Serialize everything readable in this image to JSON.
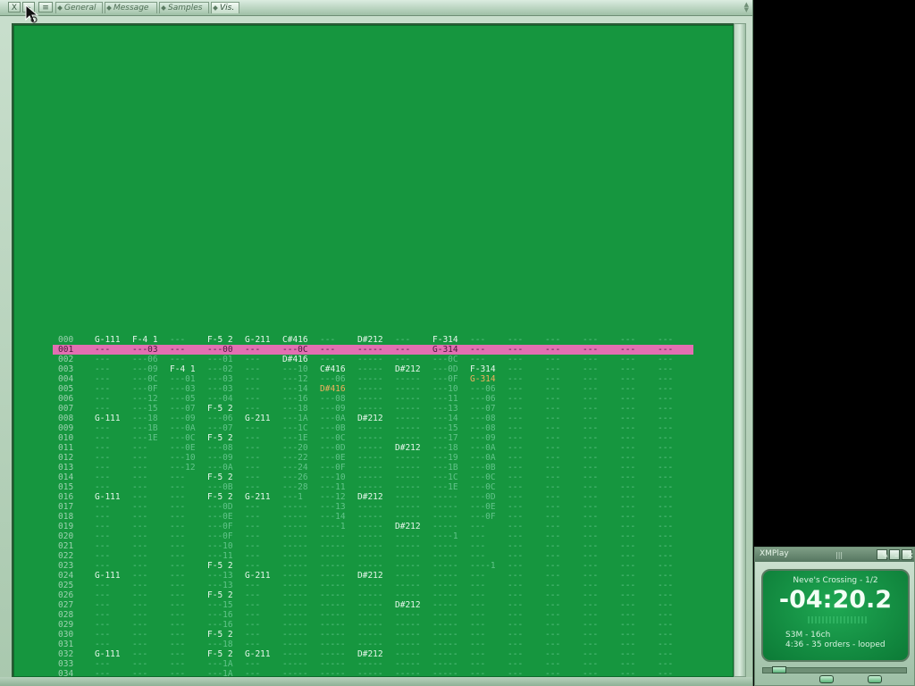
{
  "window": {
    "tabs": [
      {
        "label": "General",
        "active": false
      },
      {
        "label": "Message",
        "active": false
      },
      {
        "label": "Samples",
        "active": false
      },
      {
        "label": "Vis.",
        "active": true
      }
    ],
    "close_label": "X"
  },
  "pattern": {
    "current_row": 1,
    "rows": [
      {
        "num": "000",
        "cells": [
          "G-111",
          "F-4 1",
          "---",
          "F-5 2",
          "G-211",
          "C#416",
          "---",
          "D#212",
          "---",
          "F-314",
          "---",
          "---",
          "---",
          "---",
          "---",
          "---"
        ]
      },
      {
        "num": "001",
        "cells": [
          "---",
          "---03",
          "---",
          "---00",
          "---",
          "---0C",
          "---",
          "-----",
          "---",
          "G-314",
          "---",
          "---",
          "---",
          "---",
          "---",
          "---"
        ]
      },
      {
        "num": "002",
        "cells": [
          "---",
          "---06",
          "---",
          "---01",
          "---",
          "D#416",
          "---",
          "-----",
          "---",
          "---0C",
          "---",
          "---",
          "---",
          "---",
          "---",
          "---"
        ]
      },
      {
        "num": "003",
        "cells": [
          "---",
          "---09",
          "F-4 1",
          "---02",
          "---",
          "---10",
          "C#416",
          "-----",
          "D#212",
          "---0D",
          "F-314",
          "---",
          "---",
          "---",
          "---",
          "---"
        ]
      },
      {
        "num": "004",
        "cells": [
          "---",
          "---0C",
          "---01",
          "---03",
          "---",
          "---12",
          "---06",
          "-----",
          "-----",
          "---0F",
          "G-314",
          "---",
          "---",
          "---",
          "---",
          "---"
        ]
      },
      {
        "num": "005",
        "cells": [
          "---",
          "---0F",
          "---03",
          "---03",
          "---",
          "---14",
          "D#416",
          "-----",
          "-----",
          "---10",
          "---06",
          "---",
          "---",
          "---",
          "---",
          "---"
        ]
      },
      {
        "num": "006",
        "cells": [
          "---",
          "---12",
          "---05",
          "---04",
          "---",
          "---16",
          "---08",
          "-----",
          "-----",
          "---11",
          "---06",
          "---",
          "---",
          "---",
          "---",
          "---"
        ]
      },
      {
        "num": "007",
        "cells": [
          "---",
          "---15",
          "---07",
          "F-5 2",
          "---",
          "---18",
          "---09",
          "-----",
          "-----",
          "---13",
          "---07",
          "---",
          "---",
          "---",
          "---",
          "---"
        ]
      },
      {
        "num": "008",
        "cells": [
          "G-111",
          "---18",
          "---09",
          "---06",
          "G-211",
          "---1A",
          "---0A",
          "D#212",
          "-----",
          "---14",
          "---08",
          "---",
          "---",
          "---",
          "---",
          "---"
        ]
      },
      {
        "num": "009",
        "cells": [
          "---",
          "---1B",
          "---0A",
          "---07",
          "---",
          "---1C",
          "---0B",
          "-----",
          "-----",
          "---15",
          "---08",
          "---",
          "---",
          "---",
          "---",
          "---"
        ]
      },
      {
        "num": "010",
        "cells": [
          "---",
          "---1E",
          "---0C",
          "F-5 2",
          "---",
          "---1E",
          "---0C",
          "-----",
          "-----",
          "---17",
          "---09",
          "---",
          "---",
          "---",
          "---",
          "---"
        ]
      },
      {
        "num": "011",
        "cells": [
          "---",
          "---",
          "---0E",
          "---08",
          "---",
          "---20",
          "---0D",
          "-----",
          "D#212",
          "---18",
          "---0A",
          "---",
          "---",
          "---",
          "---",
          "---"
        ]
      },
      {
        "num": "012",
        "cells": [
          "---",
          "---",
          "---10",
          "---09",
          "---",
          "---22",
          "---0E",
          "-----",
          "-----",
          "---19",
          "---0A",
          "---",
          "---",
          "---",
          "---",
          "---"
        ]
      },
      {
        "num": "013",
        "cells": [
          "---",
          "---",
          "---12",
          "---0A",
          "---",
          "---24",
          "---0F",
          "-----",
          "-----",
          "---1B",
          "---0B",
          "---",
          "---",
          "---",
          "---",
          "---"
        ]
      },
      {
        "num": "014",
        "cells": [
          "---",
          "---",
          "---",
          "F-5 2",
          "---",
          "---26",
          "---10",
          "-----",
          "-----",
          "---1C",
          "---0C",
          "---",
          "---",
          "---",
          "---",
          "---"
        ]
      },
      {
        "num": "015",
        "cells": [
          "---",
          "---",
          "---",
          "---0B",
          "---",
          "---28",
          "---11",
          "-----",
          "-----",
          "---1E",
          "---0C",
          "---",
          "---",
          "---",
          "---",
          "---"
        ]
      },
      {
        "num": "016",
        "cells": [
          "G-111",
          "---",
          "---",
          "F-5 2",
          "G-211",
          "---1",
          "---12",
          "D#212",
          "-----",
          "-----",
          "---0D",
          "---",
          "---",
          "---",
          "---",
          "---"
        ]
      },
      {
        "num": "017",
        "cells": [
          "---",
          "---",
          "---",
          "---0D",
          "---",
          "-----",
          "---13",
          "-----",
          "-----",
          "-----",
          "---0E",
          "---",
          "---",
          "---",
          "---",
          "---"
        ]
      },
      {
        "num": "018",
        "cells": [
          "---",
          "---",
          "---",
          "---0E",
          "---",
          "-----",
          "---14",
          "-----",
          "-----",
          "-----",
          "---0F",
          "---",
          "---",
          "---",
          "---",
          "---"
        ]
      },
      {
        "num": "019",
        "cells": [
          "---",
          "---",
          "---",
          "---0F",
          "---",
          "-----",
          "----1",
          "-----",
          "D#212",
          "-----",
          "---",
          "---",
          "---",
          "---",
          "---",
          "---"
        ]
      },
      {
        "num": "020",
        "cells": [
          "---",
          "---",
          "---",
          "---0F",
          "---",
          "-----",
          "-----",
          "-----",
          "-----",
          "----1",
          "---",
          "---",
          "---",
          "---",
          "---",
          "---"
        ]
      },
      {
        "num": "021",
        "cells": [
          "---",
          "---",
          "---",
          "---10",
          "---",
          "-----",
          "-----",
          "-----",
          "-----",
          "-----",
          "---",
          "---",
          "---",
          "---",
          "---",
          "---"
        ]
      },
      {
        "num": "022",
        "cells": [
          "---",
          "---",
          "---",
          "---11",
          "---",
          "-----",
          "-----",
          "-----",
          "-----",
          "-----",
          "---",
          "---",
          "---",
          "---",
          "---",
          "---"
        ]
      },
      {
        "num": "023",
        "cells": [
          "---",
          "---",
          "---",
          "F-5 2",
          "---",
          "-----",
          "-----",
          "-----",
          "-----",
          "-----",
          "----1",
          "---",
          "---",
          "---",
          "---",
          "---"
        ]
      },
      {
        "num": "024",
        "cells": [
          "G-111",
          "---",
          "---",
          "---13",
          "G-211",
          "-----",
          "-----",
          "D#212",
          "-----",
          "-----",
          "---",
          "---",
          "---",
          "---",
          "---",
          "---"
        ]
      },
      {
        "num": "025",
        "cells": [
          "---",
          "---",
          "---",
          "---13",
          "---",
          "-----",
          "-----",
          "-----",
          "-----",
          "-----",
          "---",
          "---",
          "---",
          "---",
          "---",
          "---"
        ]
      },
      {
        "num": "026",
        "cells": [
          "---",
          "---",
          "---",
          "F-5 2",
          "---",
          "-----",
          "-----",
          "-----",
          "-----",
          "-----",
          "---",
          "---",
          "---",
          "---",
          "---",
          "---"
        ]
      },
      {
        "num": "027",
        "cells": [
          "---",
          "---",
          "---",
          "---15",
          "---",
          "-----",
          "-----",
          "-----",
          "D#212",
          "-----",
          "---",
          "---",
          "---",
          "---",
          "---",
          "---"
        ]
      },
      {
        "num": "028",
        "cells": [
          "---",
          "---",
          "---",
          "---16",
          "---",
          "-----",
          "-----",
          "-----",
          "-----",
          "-----",
          "---",
          "---",
          "---",
          "---",
          "---",
          "---"
        ]
      },
      {
        "num": "029",
        "cells": [
          "---",
          "---",
          "---",
          "---16",
          "---",
          "-----",
          "-----",
          "-----",
          "-----",
          "-----",
          "---",
          "---",
          "---",
          "---",
          "---",
          "---"
        ]
      },
      {
        "num": "030",
        "cells": [
          "---",
          "---",
          "---",
          "F-5 2",
          "---",
          "-----",
          "-----",
          "-----",
          "-----",
          "-----",
          "---",
          "---",
          "---",
          "---",
          "---",
          "---"
        ]
      },
      {
        "num": "031",
        "cells": [
          "---",
          "---",
          "---",
          "---18",
          "---",
          "-----",
          "-----",
          "-----",
          "-----",
          "-----",
          "---",
          "---",
          "---",
          "---",
          "---",
          "---"
        ]
      },
      {
        "num": "032",
        "cells": [
          "G-111",
          "---",
          "---",
          "F-5 2",
          "G-211",
          "-----",
          "-----",
          "D#212",
          "-----",
          "-----",
          "---",
          "---",
          "---",
          "---",
          "---",
          "---"
        ]
      },
      {
        "num": "033",
        "cells": [
          "---",
          "---",
          "---",
          "---1A",
          "---",
          "-----",
          "-----",
          "-----",
          "-----",
          "-----",
          "---",
          "---",
          "---",
          "---",
          "---",
          "---"
        ]
      },
      {
        "num": "034",
        "cells": [
          "---",
          "---",
          "---",
          "---1A",
          "---",
          "-----",
          "-----",
          "-----",
          "-----",
          "-----",
          "---",
          "---",
          "---",
          "---",
          "---",
          "---"
        ]
      }
    ]
  },
  "xmplay": {
    "title": "XMPlay",
    "song": "Neve's Crossing - 1/2",
    "time": "-04:20.2",
    "format": "S3M - 16ch",
    "length_info": "4:36 - 35 orders - looped",
    "buttons": {
      "tools": "✎",
      "minimize": "–",
      "close": "✕"
    },
    "seek_fraction": 0.07
  },
  "colors": {
    "panel_bg": "#16963f",
    "current_row_bg": "#e36fb2",
    "note_bright": "#e6f7eb",
    "note_dim": "#62c48a",
    "note_orange": "#f0b060"
  }
}
